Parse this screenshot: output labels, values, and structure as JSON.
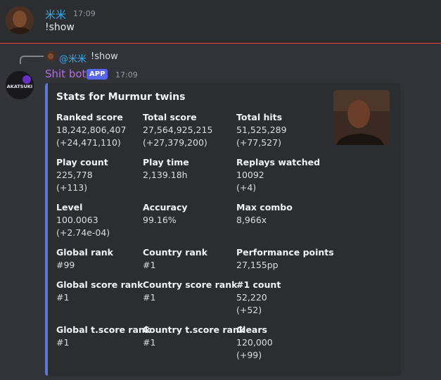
{
  "first_message": {
    "username": "米米",
    "timestamp": "17:09",
    "content": "!show"
  },
  "reply": {
    "username": "@米米",
    "content": "!show"
  },
  "bot_message": {
    "username": "Shit bot",
    "badge": "APP",
    "timestamp": "17:09",
    "avatar_text": "AKATSUKI"
  },
  "embed": {
    "accent_color": "#5f75d8",
    "title": "Stats for Murmur twins",
    "fields": [
      {
        "name": "Ranked score",
        "value": "18,242,806,407\n(+24,471,110)"
      },
      {
        "name": "Total score",
        "value": "27,564,925,215\n(+27,379,200)"
      },
      {
        "name": "Total hits",
        "value": "51,525,289\n(+77,527)"
      },
      {
        "name": "Play count",
        "value": "225,778\n(+113)"
      },
      {
        "name": "Play time",
        "value": "2,139.18h"
      },
      {
        "name": "Replays watched",
        "value": "10092\n(+4)"
      },
      {
        "name": "Level",
        "value": "100.0063\n(+2.74e-04)"
      },
      {
        "name": "Accuracy",
        "value": "99.16%"
      },
      {
        "name": "Max combo",
        "value": "8,966x"
      },
      {
        "name": "Global rank",
        "value": "#99"
      },
      {
        "name": "Country rank",
        "value": "#1"
      },
      {
        "name": "Performance points",
        "value": "27,155pp"
      },
      {
        "name": "Global score rank",
        "value": "#1"
      },
      {
        "name": "Country score rank",
        "value": "#1"
      },
      {
        "name": "#1 count",
        "value": "52,220\n(+52)"
      },
      {
        "name": "Global t.score rank",
        "value": "#1"
      },
      {
        "name": "Country t.score rank",
        "value": "#1"
      },
      {
        "name": "Clears",
        "value": "120,000\n(+99)"
      }
    ]
  }
}
